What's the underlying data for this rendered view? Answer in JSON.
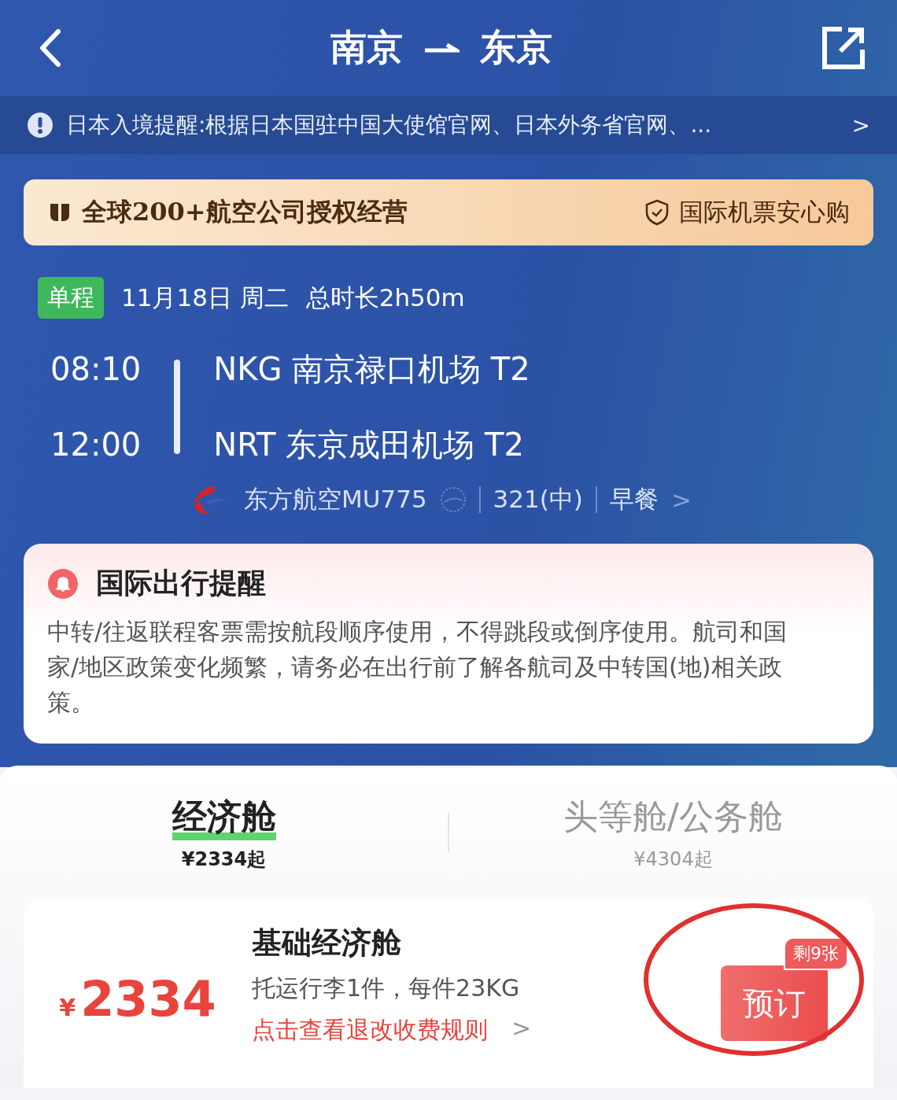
{
  "header": {
    "title_from": "南京",
    "title_to": "东京"
  },
  "notice": {
    "text": "日本入境提醒:根据日本国驻中国大使馆官网、日本外务省官网、...",
    "arrow": ">"
  },
  "banner": {
    "left": "全球200+航空公司授权经营",
    "right": "国际机票安心购"
  },
  "trip": {
    "tag": "单程",
    "date": "11月18日 周二",
    "duration": "总时长2h50m"
  },
  "segments": [
    {
      "time": "08:10",
      "airport": "NKG 南京禄口机场 T2"
    },
    {
      "time": "12:00",
      "airport": "NRT 东京成田机场 T2"
    }
  ],
  "airline": {
    "flight": "东方航空MU775",
    "aircraft": "321(中)",
    "meal": "早餐",
    "arrow": ">"
  },
  "reminder": {
    "title": "国际出行提醒",
    "body": "中转/往返联程客票需按航段顺序使用，不得跳段或倒序使用。航司和国家/地区政策变化频繁，请务必在出行前了解各航司及中转国(地)相关政策。"
  },
  "cabin_tabs": [
    {
      "label": "经济舱",
      "price": "¥2334起",
      "selected": true
    },
    {
      "label": "头等舱/公务舱",
      "price": "¥4304起",
      "selected": false
    }
  ],
  "fare": {
    "currency": "¥",
    "price": "2334",
    "name": "基础经济舱",
    "baggage": "托运行李1件，每件23KG",
    "rules_link": "点击查看退改收费规则",
    "rules_arrow": ">",
    "remaining": "剩9张",
    "book": "预订",
    "circled": true
  }
}
